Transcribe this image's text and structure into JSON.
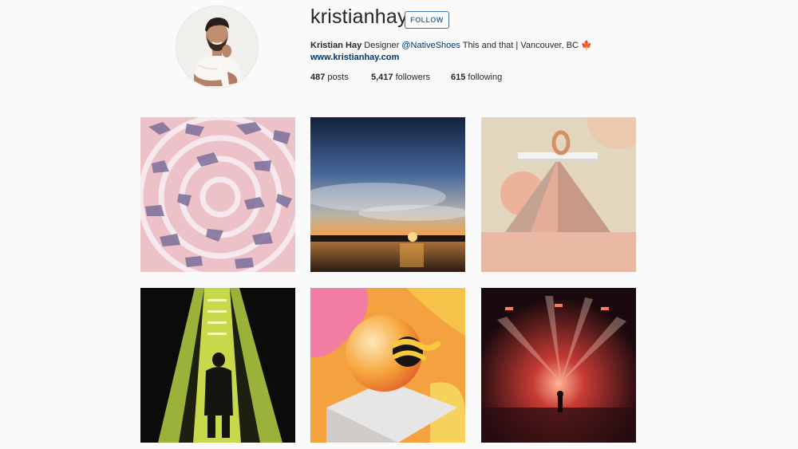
{
  "profile": {
    "username": "kristianhay",
    "follow_label": "FOLLOW",
    "full_name": "Kristian Hay",
    "bio_prefix": "Designer",
    "bio_mention": "@NativeShoes",
    "bio_suffix": "This and that | Vancouver, BC",
    "bio_emoji": "🍁",
    "website": "www.kristianhay.com"
  },
  "stats": {
    "posts_count": "487",
    "posts_label": "posts",
    "followers_count": "5,417",
    "followers_label": "followers",
    "following_count": "615",
    "following_label": "following"
  },
  "colors": {
    "accent": "#3f729b",
    "link": "#003569",
    "background": "#fafafa"
  },
  "posts": [
    {
      "subject": "pink abstract swirl"
    },
    {
      "subject": "sunset over water"
    },
    {
      "subject": "pyramid with ring"
    },
    {
      "subject": "escalator silhouette"
    },
    {
      "subject": "orange sphere on marble"
    },
    {
      "subject": "concert stage lights"
    }
  ]
}
